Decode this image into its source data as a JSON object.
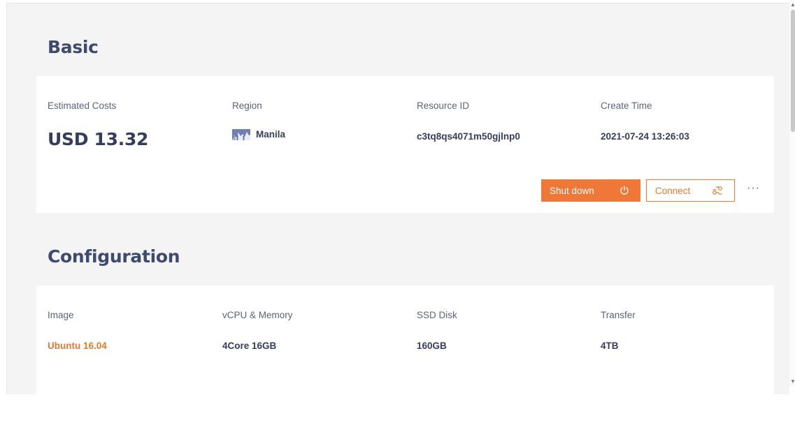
{
  "basic": {
    "title": "Basic",
    "labels": {
      "cost": "Estimated Costs",
      "region": "Region",
      "resource_id": "Resource ID",
      "create_time": "Create Time"
    },
    "values": {
      "cost": "USD 13.32",
      "region": "Manila",
      "resource_id": "c3tq8qs4071m50gjlnp0",
      "create_time": "2021-07-24 13:26:03"
    },
    "actions": {
      "shutdown": "Shut down",
      "connect": "Connect",
      "more": "···"
    }
  },
  "configuration": {
    "title": "Configuration",
    "labels": {
      "image": "Image",
      "vcpu_memory": "vCPU & Memory",
      "ssd_disk": "SSD Disk",
      "transfer": "Transfer"
    },
    "values": {
      "image": "Ubuntu 16.04",
      "vcpu_memory": "4Core 16GB",
      "ssd_disk": "160GB",
      "transfer": "4TB"
    }
  },
  "colors": {
    "accent": "#ef7737",
    "heading": "#3e4a70",
    "background": "#f4f4f4"
  }
}
